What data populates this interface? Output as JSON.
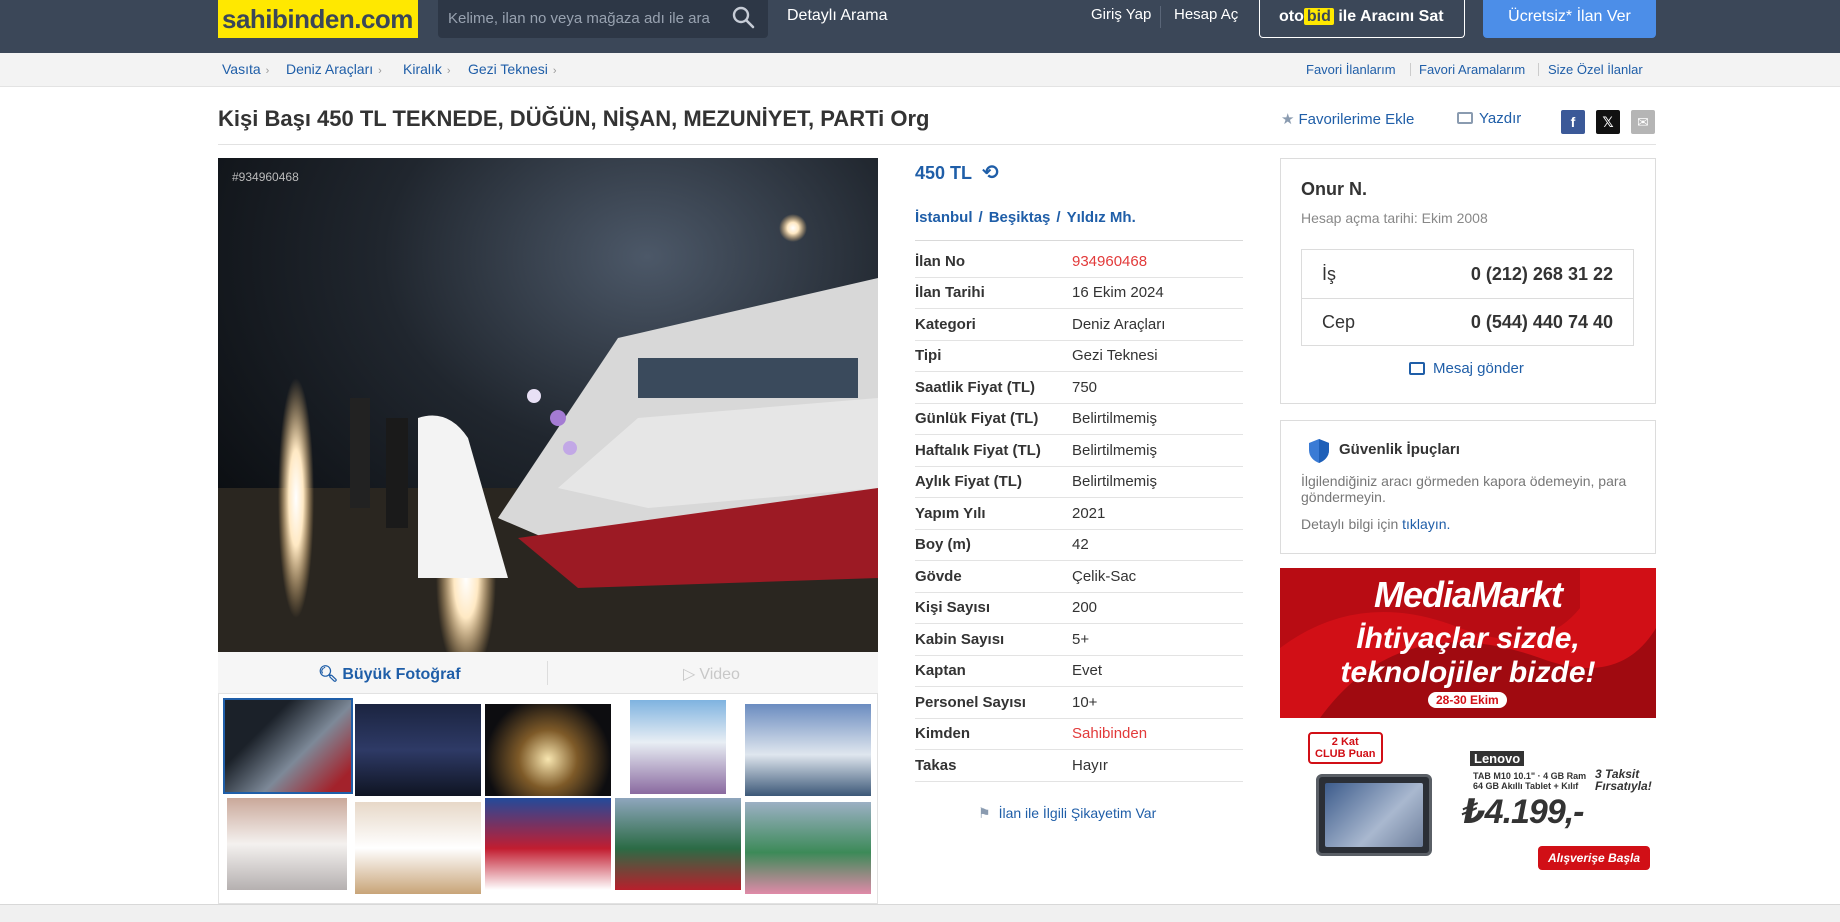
{
  "header": {
    "logo": "sahibinden.com",
    "search_placeholder": "Kelime, ilan no veya mağaza adı ile ara",
    "detailed_search": "Detaylı Arama",
    "login": "Giriş Yap",
    "register": "Hesap Aç",
    "otobid_prefix": "oto",
    "otobid_bid": "bid",
    "otobid_suffix": " ile Aracını Sat",
    "post_ad": "Ücretsiz* İlan Ver"
  },
  "breadcrumb": [
    "Vasıta",
    "Deniz Araçları",
    "Kiralık",
    "Gezi Teknesi"
  ],
  "right_links": [
    "Favori İlanlarım",
    "Favori Aramalarım",
    "Size Özel İlanlar"
  ],
  "listing": {
    "title": "Kişi Başı 450 TL TEKNEDE, DÜĞÜN, NİŞAN, MEZUNİYET, PARTi Org",
    "add_favorite": "Favorilerime Ekle",
    "print": "Yazdır",
    "image_id": "#934960468",
    "big_photo": "Büyük Fotoğraf",
    "video": "Video",
    "price": "450 TL",
    "location": [
      "İstanbul",
      "Beşiktaş",
      "Yıldız Mh."
    ],
    "complaint": "İlan ile İlgili Şikayetim Var",
    "details": [
      {
        "k": "İlan No",
        "v": "934960468",
        "red": true
      },
      {
        "k": "İlan Tarihi",
        "v": "16 Ekim 2024"
      },
      {
        "k": "Kategori",
        "v": "Deniz Araçları"
      },
      {
        "k": "Tipi",
        "v": "Gezi Teknesi"
      },
      {
        "k": "Saatlik Fiyat (TL)",
        "v": "750"
      },
      {
        "k": "Günlük Fiyat (TL)",
        "v": "Belirtilmemiş"
      },
      {
        "k": "Haftalık Fiyat (TL)",
        "v": "Belirtilmemiş"
      },
      {
        "k": "Aylık Fiyat (TL)",
        "v": "Belirtilmemiş"
      },
      {
        "k": "Yapım Yılı",
        "v": "2021"
      },
      {
        "k": "Boy (m)",
        "v": "42"
      },
      {
        "k": "Gövde",
        "v": "Çelik-Sac"
      },
      {
        "k": "Kişi Sayısı",
        "v": "200"
      },
      {
        "k": "Kabin Sayısı",
        "v": "5+"
      },
      {
        "k": "Kaptan",
        "v": "Evet"
      },
      {
        "k": "Personel Sayısı",
        "v": "10+"
      },
      {
        "k": "Kimden",
        "v": "Sahibinden",
        "red": true
      },
      {
        "k": "Takas",
        "v": "Hayır"
      }
    ]
  },
  "seller": {
    "name": "Onur N.",
    "joined": "Hesap açma tarihi: Ekim 2008",
    "phones": [
      {
        "label": "İş",
        "number": "0 (212) 268 31 22"
      },
      {
        "label": "Cep",
        "number": "0 (544) 440 74 40"
      }
    ],
    "message": "Mesaj gönder"
  },
  "safety": {
    "title": "Güvenlik İpuçları",
    "text": "İlgilendiğiniz aracı görmeden kapora ödemeyin, para göndermeyin.",
    "more_prefix": "Detaylı bilgi için ",
    "more_link": "tıklayın."
  },
  "ad": {
    "brand": "MediaMarkt",
    "line1": "İhtiyaçlar sizde,",
    "line2": "teknolojiler bizde!",
    "dates": "28-30 Ekim",
    "club": "2 Kat\nCLUB Puan",
    "lenovo": "Lenovo",
    "spec": "TAB M10 10.1\" · 4 GB Ram 64 GB Akıllı Tablet + Kılıf",
    "price": "₺4.199,-",
    "taksit": "3 Taksit Fırsatıyla!",
    "cta": "Alışverişe Başla"
  },
  "colors": {
    "header_bg": "#3b4758",
    "logo_yellow": "#ffe800",
    "link_blue": "#1f5ea8",
    "cta_blue": "#4c8ee8",
    "red": "#e23a3a",
    "ad_red": "#d10f16"
  }
}
